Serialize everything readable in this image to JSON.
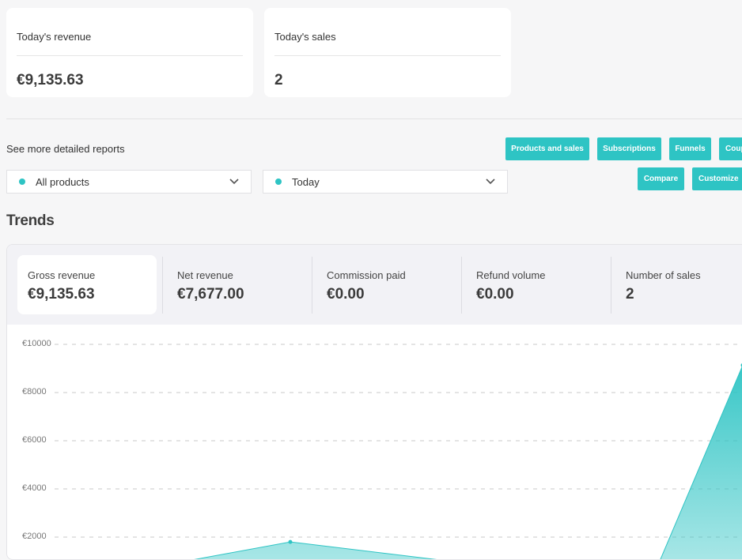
{
  "summary_cards": [
    {
      "label": "Today's revenue",
      "value": "€9,135.63"
    },
    {
      "label": "Today's sales",
      "value": "2"
    }
  ],
  "reports": {
    "label": "See more detailed reports",
    "buttons": [
      "Products and sales",
      "Subscriptions",
      "Funnels",
      "Coupons"
    ],
    "compare_label": "Compare",
    "customize_label": "Customize"
  },
  "filters": {
    "product": "All products",
    "period": "Today"
  },
  "trends": {
    "title": "Trends",
    "metrics": [
      {
        "label": "Gross revenue",
        "value": "€9,135.63",
        "active": true
      },
      {
        "label": "Net revenue",
        "value": "€7,677.00",
        "active": false
      },
      {
        "label": "Commission paid",
        "value": "€0.00",
        "active": false
      },
      {
        "label": "Refund volume",
        "value": "€0.00",
        "active": false
      },
      {
        "label": "Number of sales",
        "value": "2",
        "active": false
      }
    ]
  },
  "colors": {
    "accent": "#2ec4c4"
  },
  "icons": {
    "dropdown": "chevron-down-icon",
    "dot": "status-dot-icon"
  },
  "chart_data": {
    "type": "area",
    "y_ticks": [
      "€10000",
      "€8000",
      "€6000",
      "€4000",
      "€2000"
    ],
    "ylim": [
      0,
      10000
    ],
    "grid": true,
    "series": [
      {
        "values": [
          0,
          1800,
          0,
          9135.63
        ]
      }
    ]
  }
}
